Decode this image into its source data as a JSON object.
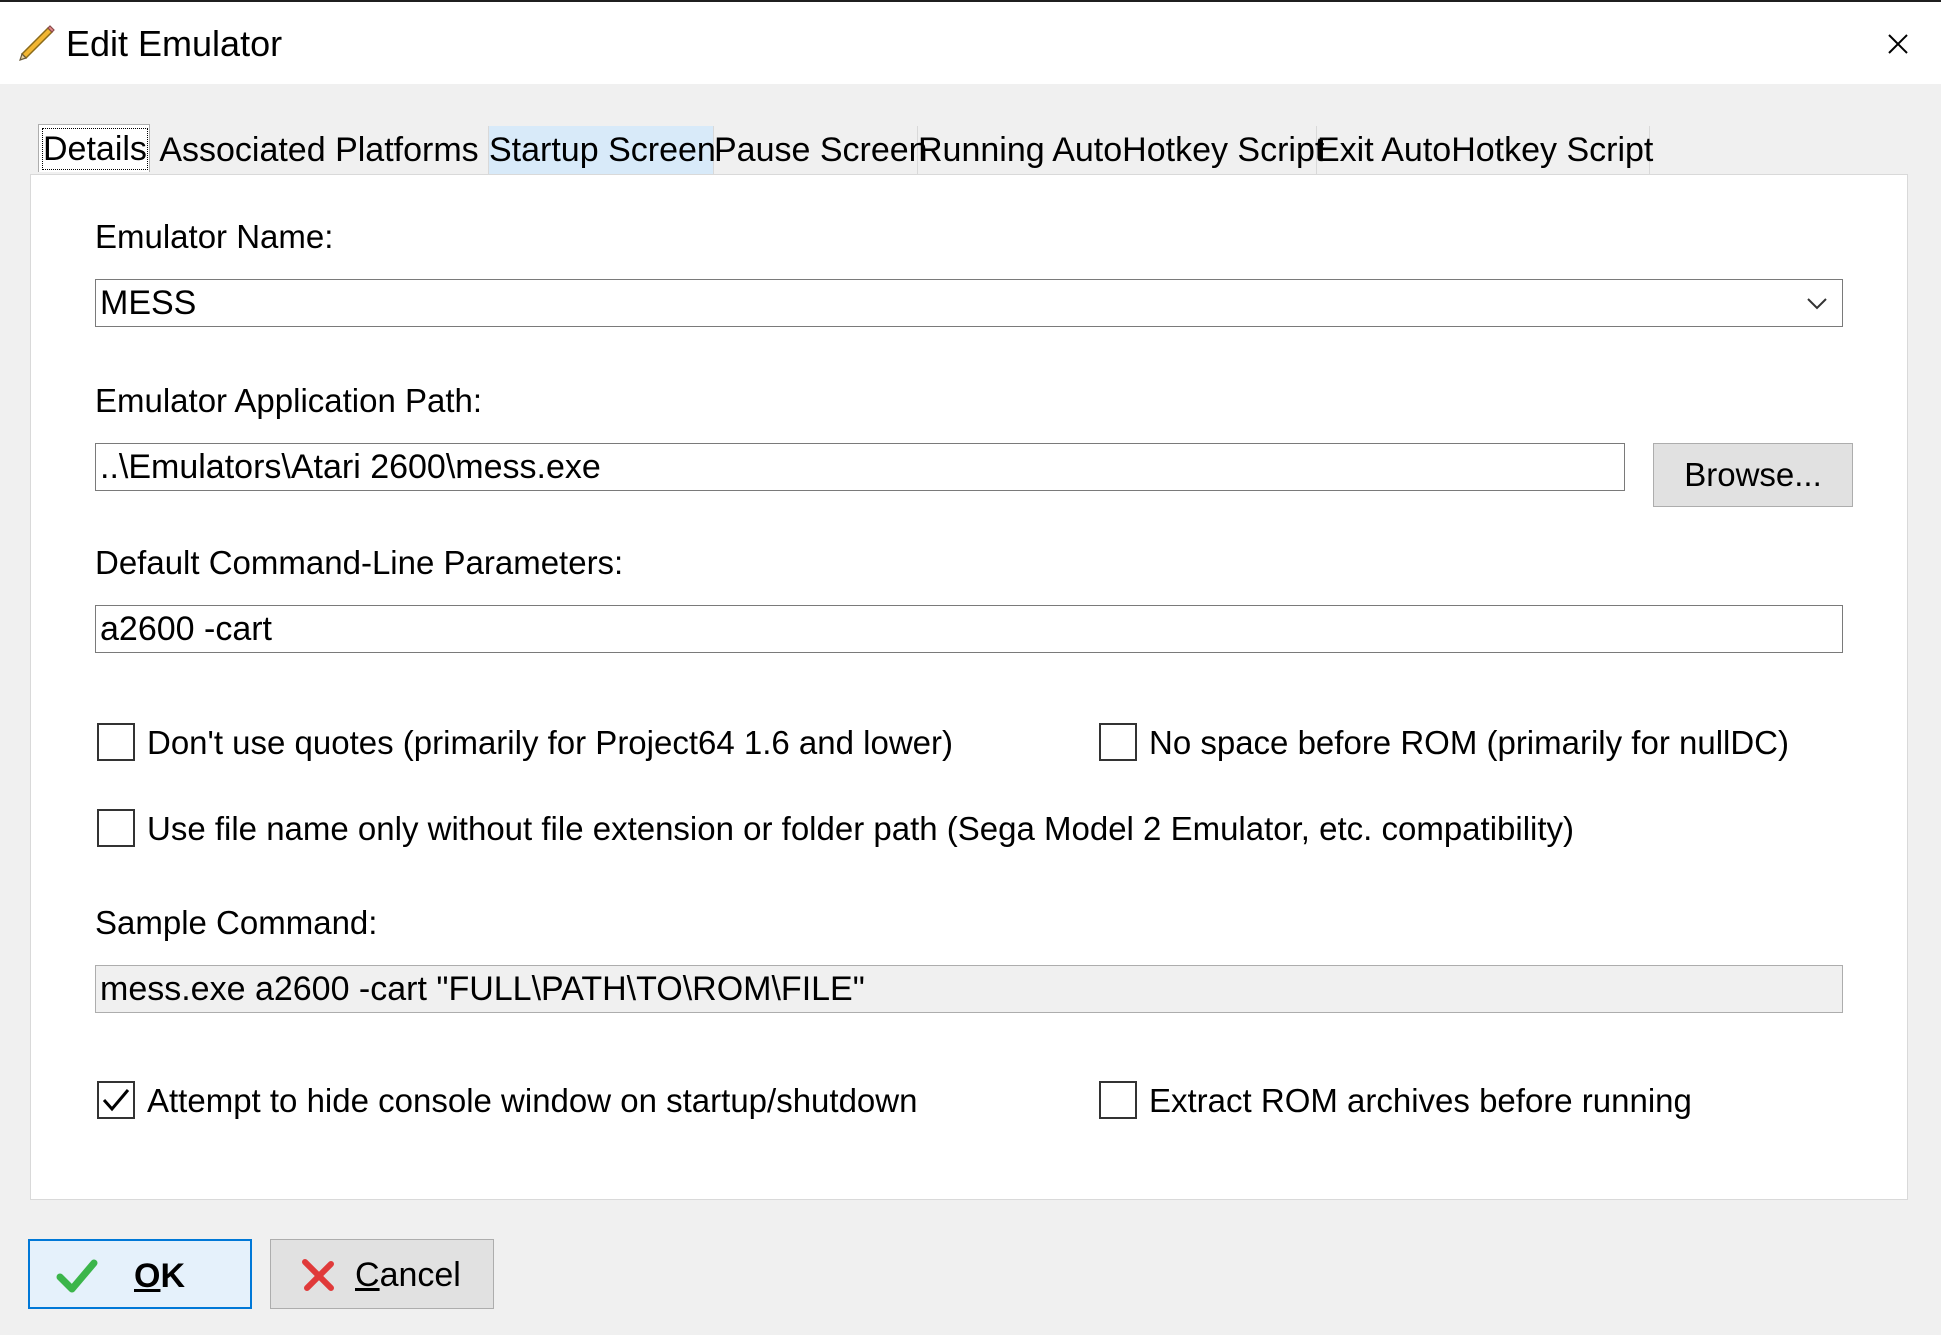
{
  "window": {
    "title": "Edit Emulator",
    "icon": "pencil-icon",
    "close_icon": "close-icon"
  },
  "tabs": [
    {
      "label": "Details",
      "active": true
    },
    {
      "label": "Associated Platforms"
    },
    {
      "label": "Startup Screen",
      "hovered": true
    },
    {
      "label": "Pause Screen"
    },
    {
      "label": "Running AutoHotkey Script"
    },
    {
      "label": "Exit AutoHotkey Script"
    }
  ],
  "details": {
    "emulator_name_label": "Emulator Name:",
    "emulator_name_value": "MESS",
    "app_path_label": "Emulator Application Path:",
    "app_path_value": "..\\Emulators\\Atari 2600\\mess.exe",
    "browse_label": "Browse...",
    "params_label": "Default Command-Line Parameters:",
    "params_value": "a2600 -cart",
    "checkboxes": {
      "no_quotes": {
        "label": "Don't use quotes (primarily for Project64 1.6 and lower)",
        "checked": false
      },
      "no_space": {
        "label": "No space before ROM (primarily for nullDC)",
        "checked": false
      },
      "file_name_only": {
        "label": "Use file name only without file extension or folder path (Sega Model 2 Emulator, etc. compatibility)",
        "checked": false
      },
      "hide_console": {
        "label": "Attempt to hide console window on startup/shutdown",
        "checked": true
      },
      "extract_rom": {
        "label": "Extract ROM archives before running",
        "checked": false
      }
    },
    "sample_label": "Sample Command:",
    "sample_value": "mess.exe a2600 -cart \"FULL\\PATH\\TO\\ROM\\FILE\""
  },
  "buttons": {
    "ok_label": "OK",
    "cancel_label": "Cancel"
  },
  "colors": {
    "accent": "#0078d7",
    "tab_hover": "#d8eaf9",
    "ok_check": "#3bb54a",
    "cancel_x": "#e03a3a"
  }
}
